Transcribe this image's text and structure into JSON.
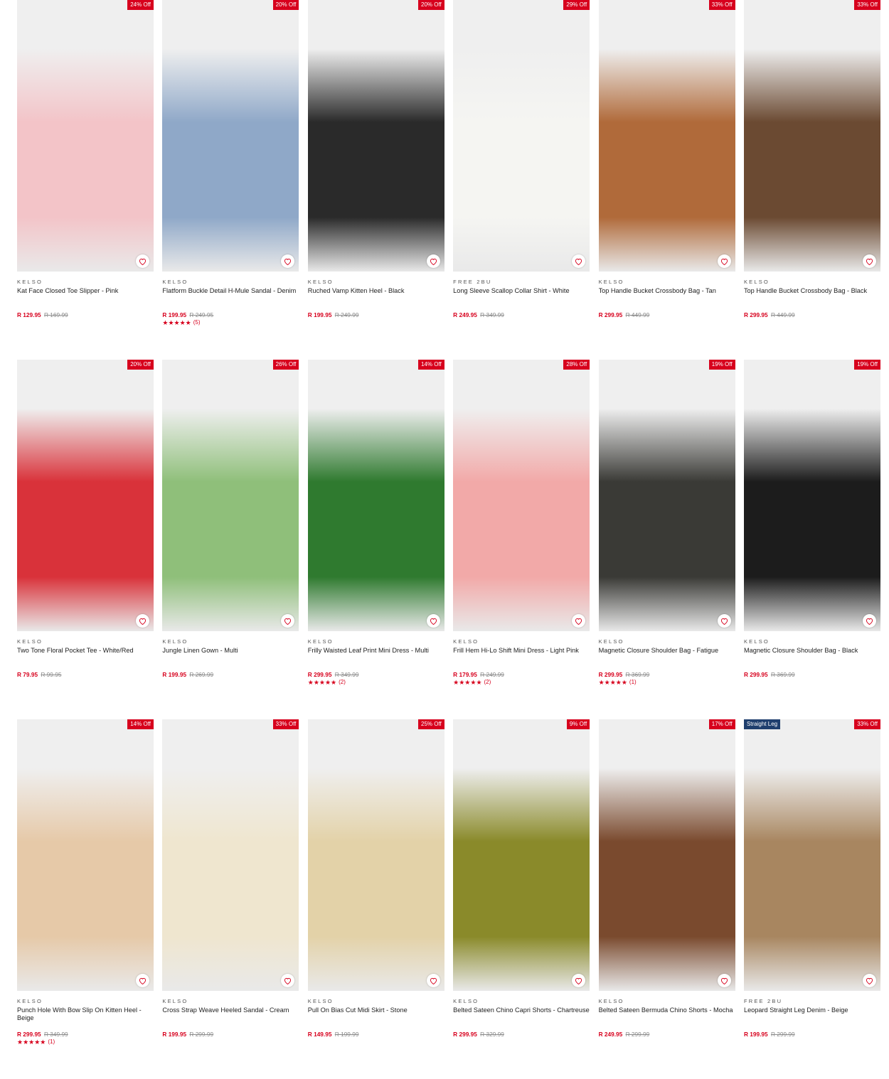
{
  "wishlist_icon": "heart-outline-icon",
  "colors": {
    "accent": "#d7001d",
    "badge_alt": "#1f3f6e",
    "placeholder": "#eeeeee"
  },
  "products": [
    {
      "brand": "KELSO",
      "name": "Kat Face Closed Toe Slipper - Pink",
      "price": "R 129.95",
      "was": "R 169.99",
      "badge": "24% Off",
      "stars": "",
      "reviews": "",
      "image_color": "#f3c4c8"
    },
    {
      "brand": "KELSO",
      "name": "Flatform Buckle Detail H-Mule Sandal - Denim",
      "price": "R 199.95",
      "was": "R 249.95",
      "badge": "20% Off",
      "stars": "★★★★★",
      "reviews": "(5)",
      "image_color": "#8fa8c8"
    },
    {
      "brand": "KELSO",
      "name": "Ruched Vamp Kitten Heel - Black",
      "price": "R 199.95",
      "was": "R 249.99",
      "badge": "20% Off",
      "stars": "",
      "reviews": "",
      "image_color": "#2a2a2a"
    },
    {
      "brand": "FREE 2BU",
      "name": "Long Sleeve Scallop Collar Shirt - White",
      "price": "R 249.95",
      "was": "R 349.99",
      "badge": "29% Off",
      "stars": "",
      "reviews": "",
      "image_color": "#f5f5f2"
    },
    {
      "brand": "KELSO",
      "name": "Top Handle Bucket Crossbody Bag - Tan",
      "price": "R 299.95",
      "was": "R 449.99",
      "badge": "33% Off",
      "stars": "",
      "reviews": "",
      "image_color": "#b06a3a"
    },
    {
      "brand": "KELSO",
      "name": "Top Handle Bucket Crossbody Bag - Black",
      "price": "R 299.95",
      "was": "R 449.99",
      "badge": "33% Off",
      "stars": "",
      "reviews": "",
      "image_color": "#6b4a32"
    },
    {
      "brand": "KELSO",
      "name": "Two Tone Floral Pocket Tee - White/Red",
      "price": "R 79.95",
      "was": "R 99.95",
      "badge": "20% Off",
      "stars": "",
      "reviews": "",
      "image_color": "#d9323a"
    },
    {
      "brand": "KELSO",
      "name": "Jungle Linen Gown - Multi",
      "price": "R 199.95",
      "was": "R 269.99",
      "badge": "26% Off",
      "stars": "",
      "reviews": "",
      "image_color": "#8fbf7a"
    },
    {
      "brand": "KELSO",
      "name": "Frilly Waisted Leaf Print Mini Dress - Multi",
      "price": "R 299.95",
      "was": "R 349.99",
      "badge": "14% Off",
      "stars": "★★★★★",
      "reviews": "(2)",
      "image_color": "#2f7a2f"
    },
    {
      "brand": "KELSO",
      "name": "Frill Hem Hi-Lo Shift Mini Dress - Light Pink",
      "price": "R 179.95",
      "was": "R 249.99",
      "badge": "28% Off",
      "stars": "★★★★★",
      "reviews": "(2)",
      "image_color": "#f2a9a8"
    },
    {
      "brand": "KELSO",
      "name": "Magnetic Closure Shoulder Bag - Fatigue",
      "price": "R 299.95",
      "was": "R 369.99",
      "badge": "19% Off",
      "stars": "★★★★★",
      "reviews": "(1)",
      "image_color": "#3a3a36"
    },
    {
      "brand": "KELSO",
      "name": "Magnetic Closure Shoulder Bag - Black",
      "price": "R 299.95",
      "was": "R 369.99",
      "badge": "19% Off",
      "stars": "",
      "reviews": "",
      "image_color": "#1c1c1c"
    },
    {
      "brand": "KELSO",
      "name": "Punch Hole With Bow Slip On Kitten Heel - Beige",
      "price": "R 299.95",
      "was": "R 349.99",
      "badge": "14% Off",
      "stars": "★★★★★",
      "reviews": "(1)",
      "image_color": "#e6c9a8"
    },
    {
      "brand": "KELSO",
      "name": "Cross Strap Weave Heeled Sandal - Cream",
      "price": "R 199.95",
      "was": "R 299.99",
      "badge": "33% Off",
      "stars": "",
      "reviews": "",
      "image_color": "#efe6cf"
    },
    {
      "brand": "KELSO",
      "name": "Pull On Bias Cut Midi Skirt - Stone",
      "price": "R 149.95",
      "was": "R 199.99",
      "badge": "25% Off",
      "stars": "",
      "reviews": "",
      "image_color": "#e3d2a8"
    },
    {
      "brand": "KELSO",
      "name": "Belted Sateen Chino Capri Shorts - Chartreuse",
      "price": "R 299.95",
      "was": "R 329.99",
      "badge": "9% Off",
      "stars": "",
      "reviews": "",
      "image_color": "#8a8a2a"
    },
    {
      "brand": "KELSO",
      "name": "Belted Sateen Bermuda Chino Shorts - Mocha",
      "price": "R 249.95",
      "was": "R 299.99",
      "badge": "17% Off",
      "stars": "",
      "reviews": "",
      "image_color": "#7a4a2e"
    },
    {
      "brand": "FREE 2BU",
      "name": "Leopard Straight Leg Denim - Beige",
      "price": "R 199.95",
      "was": "R 299.99",
      "badge": "33% Off",
      "tag": "Straight Leg",
      "stars": "",
      "reviews": "",
      "image_color": "#a88660"
    }
  ]
}
